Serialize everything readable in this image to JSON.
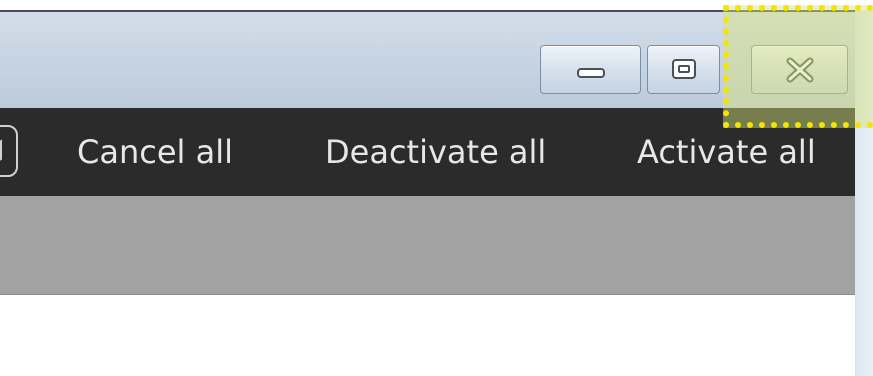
{
  "window_controls": {
    "minimize_icon": "minimize-icon",
    "maximize_icon": "maximize-icon",
    "close_icon": "close-icon"
  },
  "toolbar": {
    "leading_icon": "lock-icon",
    "buttons": [
      {
        "label": "Cancel all"
      },
      {
        "label": "Deactivate all"
      },
      {
        "label": "Activate all"
      }
    ]
  },
  "colors": {
    "titlebar": "#c6d3e2",
    "toolbar": "#2b2b2b",
    "toolbar_text": "#e7e7e7",
    "gray_bar": "#a2a2a2",
    "highlight": "#f2e600"
  }
}
